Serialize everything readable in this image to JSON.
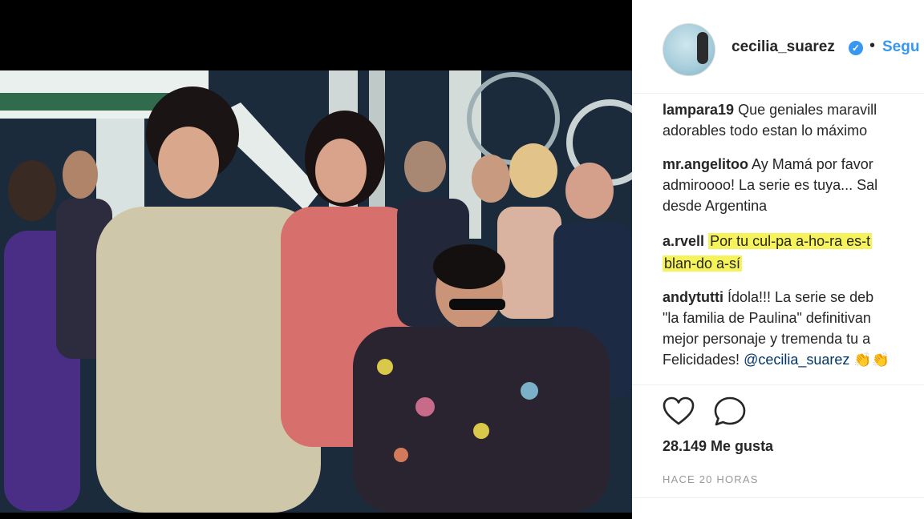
{
  "post": {
    "username": "cecilia_suarez",
    "verified_symbol": "✓",
    "separator": "•",
    "follow_label": "Segu"
  },
  "comments": [
    {
      "user": "lampara19",
      "lines": [
        "Que geniales maravill",
        "adorables todo estan lo máximo"
      ]
    },
    {
      "user": "mr.angelitoo",
      "lines": [
        "Ay Mamá por favor",
        "admiroooo! La serie es tuya... Sal",
        "desde Argentina"
      ]
    },
    {
      "user": "a.rvell",
      "lines": [
        "Por tu cul-pa a-ho-ra es-t",
        "blan-do a-sí"
      ]
    },
    {
      "user": "andytutti",
      "lines": [
        "Ídola!!! La serie se deb",
        "\"la familia de Paulina\" definitivan",
        "mejor personaje y tremenda tu a",
        "Felicidades! "
      ],
      "mention": "@cecilia_suarez",
      "emoji": "👏👏"
    }
  ],
  "actions": {
    "likes": "28.149 Me gusta",
    "time": "HACE 20 HORAS"
  },
  "colors": {
    "highlight": "#f6f35a",
    "link": "#3897f0",
    "verified": "#3897f0"
  }
}
